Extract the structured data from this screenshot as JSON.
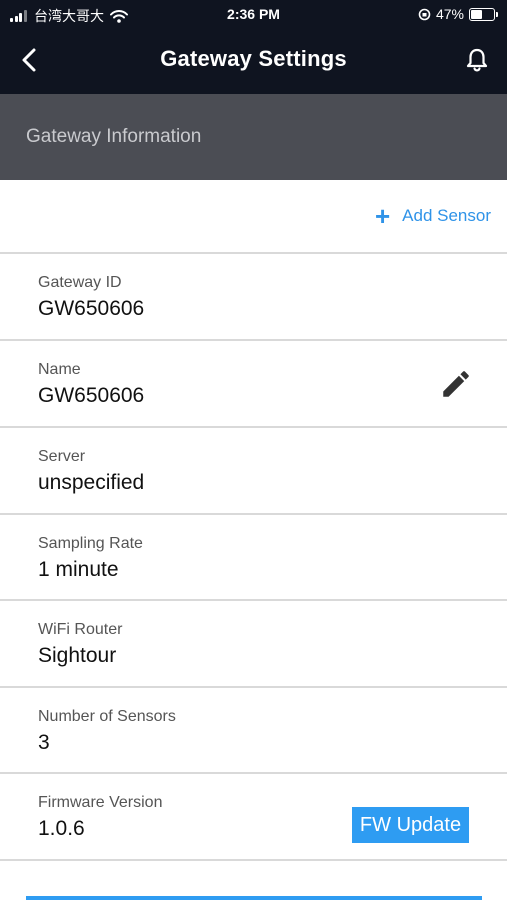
{
  "status_bar": {
    "carrier": "台湾大哥大",
    "time": "2:36 PM",
    "battery_percent": "47%",
    "battery_level": 0.47
  },
  "nav": {
    "title": "Gateway Settings"
  },
  "section": {
    "title": "Gateway Information"
  },
  "actions": {
    "add_sensor": "Add Sensor",
    "fw_update": "FW Update"
  },
  "fields": [
    {
      "label": "Gateway ID",
      "value": "GW650606"
    },
    {
      "label": "Name",
      "value": "GW650606"
    },
    {
      "label": "Server",
      "value": "unspecified"
    },
    {
      "label": "Sampling Rate",
      "value": "1 minute"
    },
    {
      "label": "WiFi Router",
      "value": "Sightour"
    },
    {
      "label": "Number of Sensors",
      "value": "3"
    },
    {
      "label": "Firmware Version",
      "value": "1.0.6"
    }
  ],
  "colors": {
    "nav_bg": "#0f1420",
    "section_bg": "#4b4d54",
    "accent": "#2e9cf2"
  }
}
